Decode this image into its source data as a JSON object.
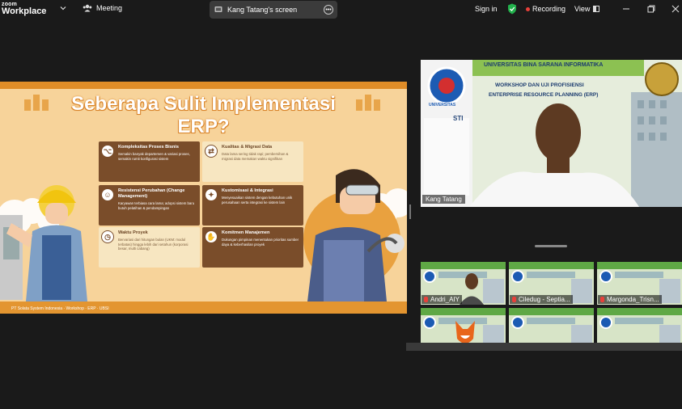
{
  "app": {
    "logo_line1": "zoom",
    "logo_line2": "Workplace",
    "meeting_label": "Meeting",
    "shared_screen_label": "Kang Tatang's screen",
    "sign_in": "Sign in",
    "recording": "Recording",
    "view": "View",
    "colors": {
      "recording_dot": "#e8403a",
      "shield": "#22b14c"
    }
  },
  "slide": {
    "title_line1": "Seberapa Sulit Implementasi",
    "title_line2": "ERP?",
    "footer": "PT Solata System Indonesia   ·   Workshop · ERP   ·   UBSI",
    "cards": [
      {
        "title": "Kompleksitas Proses Bisnis",
        "desc": "Semakin banyak departemen & variasi proses, semakin rumit konfigurasi sistem",
        "icon": "org-chart-icon"
      },
      {
        "title": "Kualitas & Migrasi Data",
        "desc": "Data lama sering tidak rapi; pembersihan & migrasi data memakan waktu signifikan",
        "icon": "data-migration-icon"
      },
      {
        "title": "Resistensi Perubahan (Change Management)",
        "desc": "Karyawan terbiasa cara lama; adopsi sistem baru butuh pelatihan & pendampingan",
        "icon": "people-icon"
      },
      {
        "title": "Kustomisasi & Integrasi",
        "desc": "Menyesuaikan sistem dengan kebutuhan unik perusahaan serta integrasi ke sistem lain",
        "icon": "puzzle-icon"
      },
      {
        "title": "Waktu Proyek",
        "desc": "Bervariasi dari hitungan bulan (UKM: modul terbatas) hingga lebih dari setahun (korporasi besar, multi cabang)",
        "icon": "clock-icon"
      },
      {
        "title": "Komitmen Manajemen",
        "desc": "Dukungan pimpinan menentukan prioritas sumber daya & keberhasilan proyek",
        "icon": "handshake-icon"
      }
    ]
  },
  "speaker": {
    "name": "Kang Tatang",
    "banner_title": "UNIVERSITAS BINA SARANA INFORMATIKA",
    "banner_sub1": "WORKSHOP DAN UJI PROFISIENSI",
    "banner_sub2": "ENTERPRISE RESOURCE PLANNING (ERP)",
    "logo_text": "UNIVERSITAS",
    "partner_text": "STI"
  },
  "gallery": [
    {
      "name": "Andri_AIY",
      "muted": true
    },
    {
      "name": "Ciledug - Septia...",
      "muted": true
    },
    {
      "name": "Margonda_Trisn...",
      "muted": true
    },
    {
      "name": "",
      "muted": false
    },
    {
      "name": "",
      "muted": false
    },
    {
      "name": "",
      "muted": false
    }
  ]
}
